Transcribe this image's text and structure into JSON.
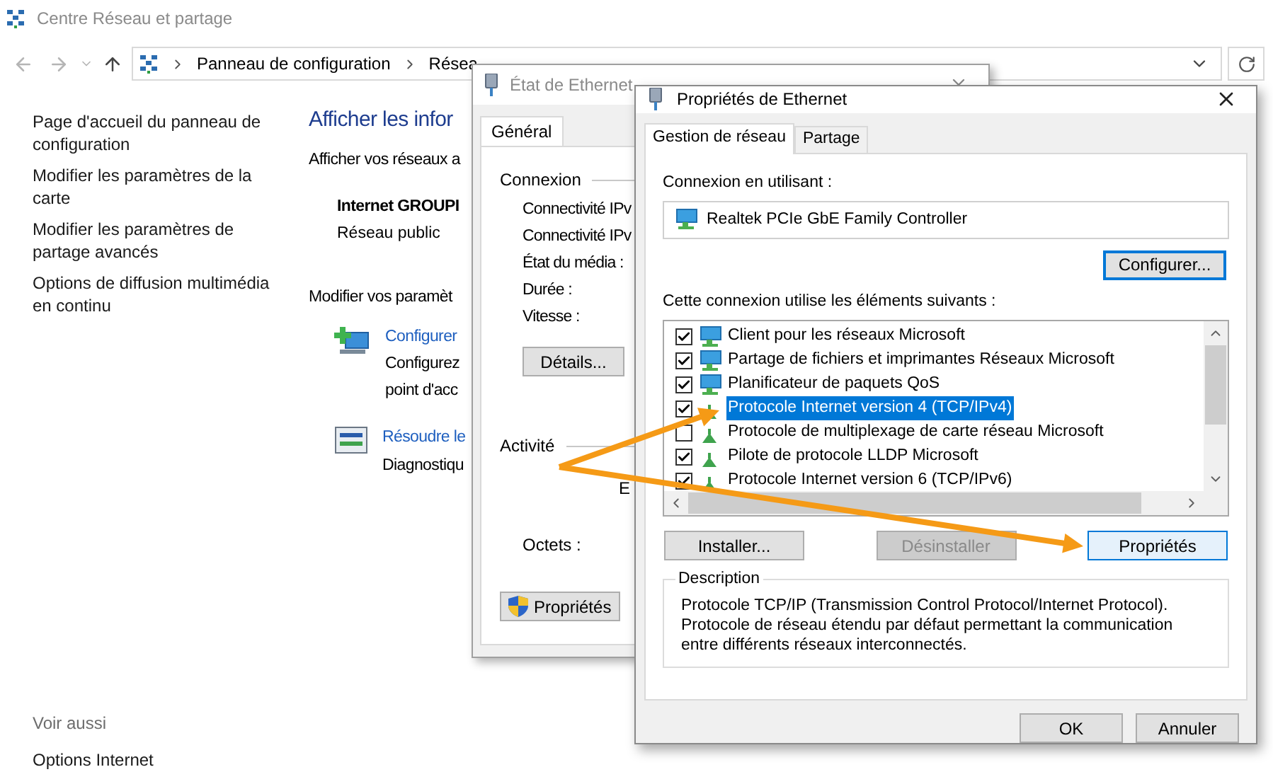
{
  "main_window": {
    "title": "Centre Réseau et partage",
    "breadcrumb": [
      "Panneau de configuration",
      "Résea"
    ],
    "sidebar": {
      "links": [
        "Page d'accueil du panneau de configuration",
        "Modifier les paramètres de la carte",
        "Modifier les paramètres de partage avancés",
        "Options de diffusion multimédia en continu"
      ],
      "see_also": {
        "heading": "Voir aussi",
        "links": [
          "Options Internet"
        ]
      }
    },
    "content": {
      "heading": "Afficher les infor",
      "subheading": "Afficher vos réseaux a",
      "network": {
        "name": "Internet GROUPI",
        "type": "Réseau public"
      },
      "settings_heading": "Modifier vos paramèt",
      "tasks": [
        {
          "kind": "setup",
          "title": "Configurer",
          "description": [
            "Configurez",
            "point d'acc"
          ]
        },
        {
          "kind": "troubleshoot",
          "title": "Résoudre le",
          "description": [
            "Diagnostiqu"
          ]
        }
      ]
    }
  },
  "status_window": {
    "title": "État de Ethernet",
    "tabs": [
      {
        "label": "Général",
        "selected": true
      }
    ],
    "connection": {
      "heading": "Connexion",
      "fields": [
        "Connectivité IPv",
        "Connectivité IPv",
        "État du média :",
        "Durée :",
        "Vitesse :"
      ],
      "details_button": "Détails..."
    },
    "activity": {
      "heading": "Activité",
      "column_label": "E",
      "rows": [
        "Octets :"
      ]
    },
    "buttons": [
      "Propriétés"
    ]
  },
  "properties_dialog": {
    "title": "Propriétés de Ethernet",
    "tabs": [
      {
        "label": "Gestion de réseau",
        "selected": true
      },
      {
        "label": "Partage",
        "selected": false
      }
    ],
    "connect_using_label": "Connexion en utilisant :",
    "adapter": "Realtek PCIe GbE Family Controller",
    "configure_button": {
      "label": "Configurer...",
      "focused": true
    },
    "components_label": "Cette connexion utilise les éléments suivants :",
    "components": [
      {
        "kind": "computer",
        "label": "Client pour les réseaux Microsoft",
        "checked": true,
        "selected": false
      },
      {
        "kind": "computer",
        "label": "Partage de fichiers et imprimantes Réseaux Microsoft",
        "checked": true,
        "selected": false
      },
      {
        "kind": "computer",
        "label": "Planificateur de paquets QoS",
        "checked": true,
        "selected": false
      },
      {
        "kind": "protocol",
        "label": "Protocole Internet version 4 (TCP/IPv4)",
        "checked": true,
        "selected": true
      },
      {
        "kind": "protocol",
        "label": "Protocole de multiplexage de carte réseau Microsoft",
        "checked": false,
        "selected": false
      },
      {
        "kind": "protocol",
        "label": "Pilote de protocole LLDP Microsoft",
        "checked": true,
        "selected": false
      },
      {
        "kind": "protocol",
        "label": "Protocole Internet version 6 (TCP/IPv6)",
        "checked": true,
        "selected": false
      }
    ],
    "buttons": [
      {
        "label": "Installer...",
        "disabled": false,
        "default": false
      },
      {
        "label": "Désinstaller",
        "disabled": true,
        "default": false
      },
      {
        "label": "Propriétés",
        "disabled": false,
        "default": true
      }
    ],
    "description": {
      "heading": "Description",
      "text": "Protocole TCP/IP (Transmission Control Protocol/Internet Protocol). Protocole de réseau étendu par défaut permettant la communication entre différents réseaux interconnectés."
    },
    "footer_buttons": [
      "OK",
      "Annuler"
    ]
  }
}
